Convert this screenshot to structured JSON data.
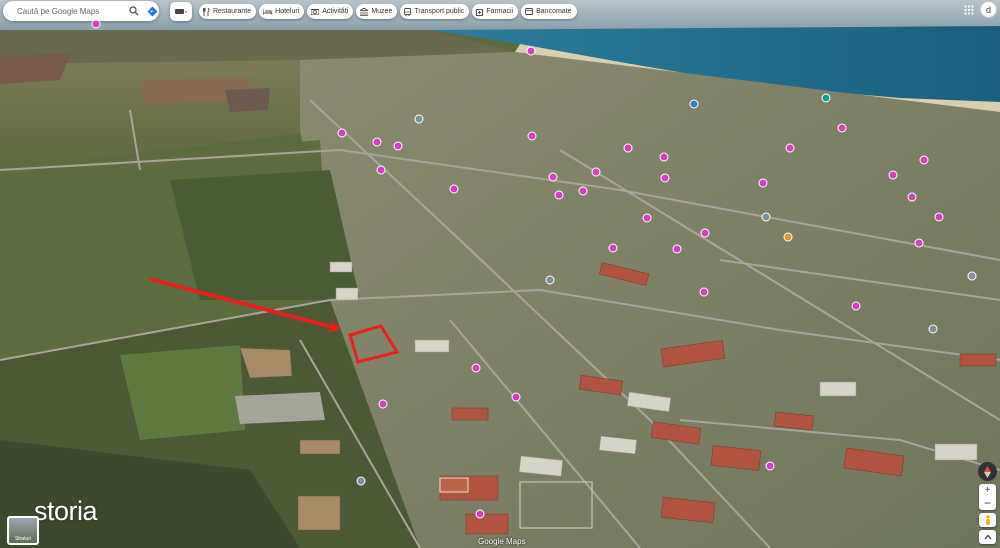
{
  "search": {
    "placeholder": "Caută pe Google Maps"
  },
  "chips": [
    {
      "label": "Restaurante",
      "icon": "fork-knife-icon"
    },
    {
      "label": "Hoteluri",
      "icon": "bed-icon"
    },
    {
      "label": "Activități",
      "icon": "camera-icon"
    },
    {
      "label": "Muzee",
      "icon": "museum-icon"
    },
    {
      "label": "Transport public",
      "icon": "bus-icon"
    },
    {
      "label": "Farmacii",
      "icon": "pharmacy-icon"
    },
    {
      "label": "Bancomate",
      "icon": "atm-icon"
    }
  ],
  "account": {
    "initial": "d"
  },
  "watermark": {
    "text": "storia"
  },
  "layers": {
    "label": "Straturi"
  },
  "attribution": {
    "text": "Google Maps"
  },
  "colors": {
    "marker_pink": "#d63fc4",
    "marker_blue": "#3a7ec9",
    "arrow_red": "#e8201a",
    "parcel_red": "#e8201a",
    "sea": "#1f6b8a"
  },
  "markers": [
    {
      "type": "pink"
    },
    {
      "type": "pink"
    },
    {
      "type": "pink"
    },
    {
      "type": "pink"
    },
    {
      "type": "pink"
    },
    {
      "type": "pink"
    },
    {
      "type": "pink"
    },
    {
      "type": "pink"
    },
    {
      "type": "pink"
    },
    {
      "type": "pink"
    },
    {
      "type": "pink"
    },
    {
      "type": "pink"
    },
    {
      "type": "pink"
    },
    {
      "type": "pink"
    },
    {
      "type": "pink"
    },
    {
      "type": "pink"
    },
    {
      "type": "pink"
    },
    {
      "type": "pink"
    },
    {
      "type": "pink"
    },
    {
      "type": "pink"
    },
    {
      "type": "pink"
    },
    {
      "type": "pink"
    },
    {
      "type": "pink"
    },
    {
      "type": "pink"
    },
    {
      "type": "pink"
    },
    {
      "type": "pink"
    },
    {
      "type": "pink"
    },
    {
      "type": "pink"
    },
    {
      "type": "pink"
    },
    {
      "type": "pink"
    },
    {
      "type": "pink"
    },
    {
      "type": "blue"
    },
    {
      "type": "teal"
    },
    {
      "type": "gray"
    },
    {
      "type": "gray"
    },
    {
      "type": "gray"
    },
    {
      "type": "orange"
    },
    {
      "type": "gray"
    },
    {
      "type": "gray"
    }
  ]
}
